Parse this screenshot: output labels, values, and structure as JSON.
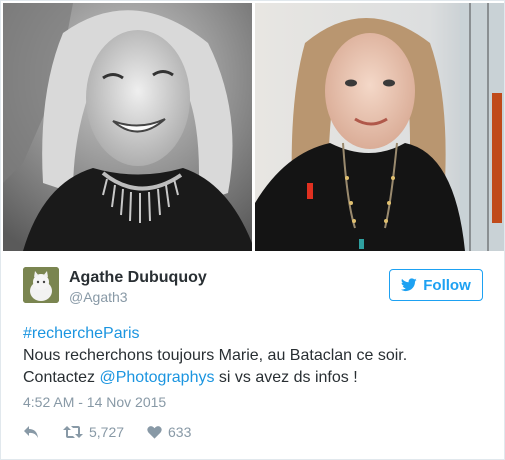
{
  "tweet": {
    "author": {
      "display_name": "Agathe Dubuquoy",
      "handle": "@Agath3",
      "avatar_icon": "cat-avatar-icon"
    },
    "follow": {
      "label": "Follow",
      "icon": "bird-icon",
      "color": "#1da1f2"
    },
    "text": {
      "hashtag": "#rechercheParis",
      "line1": "Nous recherchons toujours Marie, au Bataclan ce soir.",
      "line2_prefix": "Contactez ",
      "mention": "@Photographys",
      "line2_suffix": " si vs avez ds infos !"
    },
    "timestamp": "4:52 AM - 14 Nov 2015",
    "actions": {
      "reply_icon": "reply-icon",
      "retweet_icon": "retweet-icon",
      "retweet_count": "5,727",
      "like_icon": "heart-icon",
      "like_count": "633"
    },
    "photos": [
      {
        "name": "photo-black-white-portrait"
      },
      {
        "name": "photo-color-portrait"
      }
    ],
    "colors": {
      "link": "#1b95e0",
      "secondary_text": "#8899a6",
      "primary_text": "#292f33"
    }
  }
}
